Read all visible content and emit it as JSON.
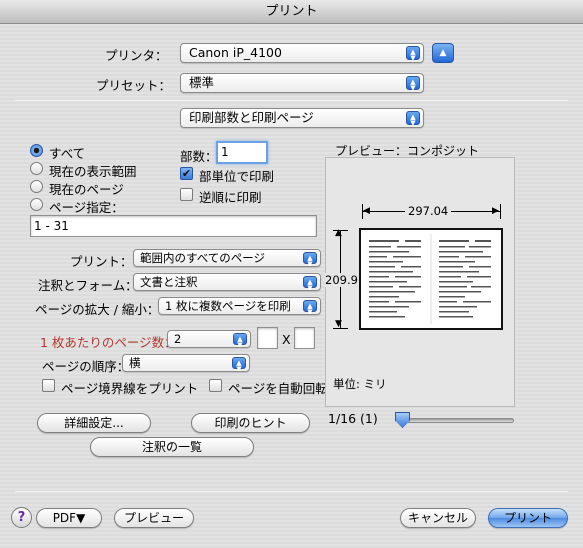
{
  "window": {
    "title": "プリント"
  },
  "printer": {
    "label": "プリンタ：",
    "value": "Canon iP_4100"
  },
  "presets": {
    "label": "プリセット：",
    "value": "標準"
  },
  "section": {
    "value": "印刷部数と印刷ページ"
  },
  "pages": {
    "options": [
      "すべて",
      "現在の表示範囲",
      "現在のページ",
      "ページ指定："
    ],
    "selected": 0,
    "range_value": "1 - 31"
  },
  "copies": {
    "label": "部数：",
    "value": "1",
    "collate_label": "部単位で印刷",
    "collate_checked": true,
    "reverse_label": "逆順に印刷",
    "reverse_checked": false
  },
  "options": {
    "print_label": "プリント：",
    "print_value": "範囲内のすべてのページ",
    "annotations_label": "注釈とフォーム：",
    "annotations_value": "文書と注釈",
    "scaling_label": "ページの拡大 / 縮小：",
    "scaling_value": "1 枚に複数ページを印刷",
    "per_sheet_label": "1 枚あたりのページ数：",
    "per_sheet_value": "2",
    "grid_x": "",
    "times": "X",
    "grid_y": "",
    "order_label": "ページの順序：",
    "order_value": "横",
    "borders_label": "ページ境界線をプリント",
    "borders_checked": false,
    "autorotate_label": "ページを自動回転",
    "autorotate_checked": false
  },
  "buttons": {
    "advanced": "詳細設定...",
    "hints": "印刷のヒント",
    "comments": "注釈の一覧",
    "pdf": "PDF▼",
    "preview": "プレビュー",
    "cancel": "キャンセル",
    "print": "プリント",
    "help": "?"
  },
  "preview": {
    "title": "プレビュー：コンポジット",
    "width_dim": "297.04",
    "height_dim": "209.9",
    "unit": "単位: ミリ",
    "page_indicator": "1/16 (1)",
    "slider_fraction": 0
  },
  "icons": {
    "stepper": "up-down-arrows-icon",
    "disclosure": "triangle-up-icon"
  }
}
